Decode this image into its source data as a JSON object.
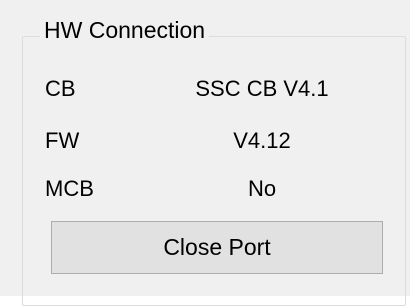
{
  "hw_connection": {
    "title": "HW Connection",
    "rows": [
      {
        "label": "CB",
        "value": "SSC CB V4.1"
      },
      {
        "label": "FW",
        "value": "V4.12"
      },
      {
        "label": "MCB",
        "value": "No"
      }
    ],
    "close_port_label": "Close Port"
  }
}
